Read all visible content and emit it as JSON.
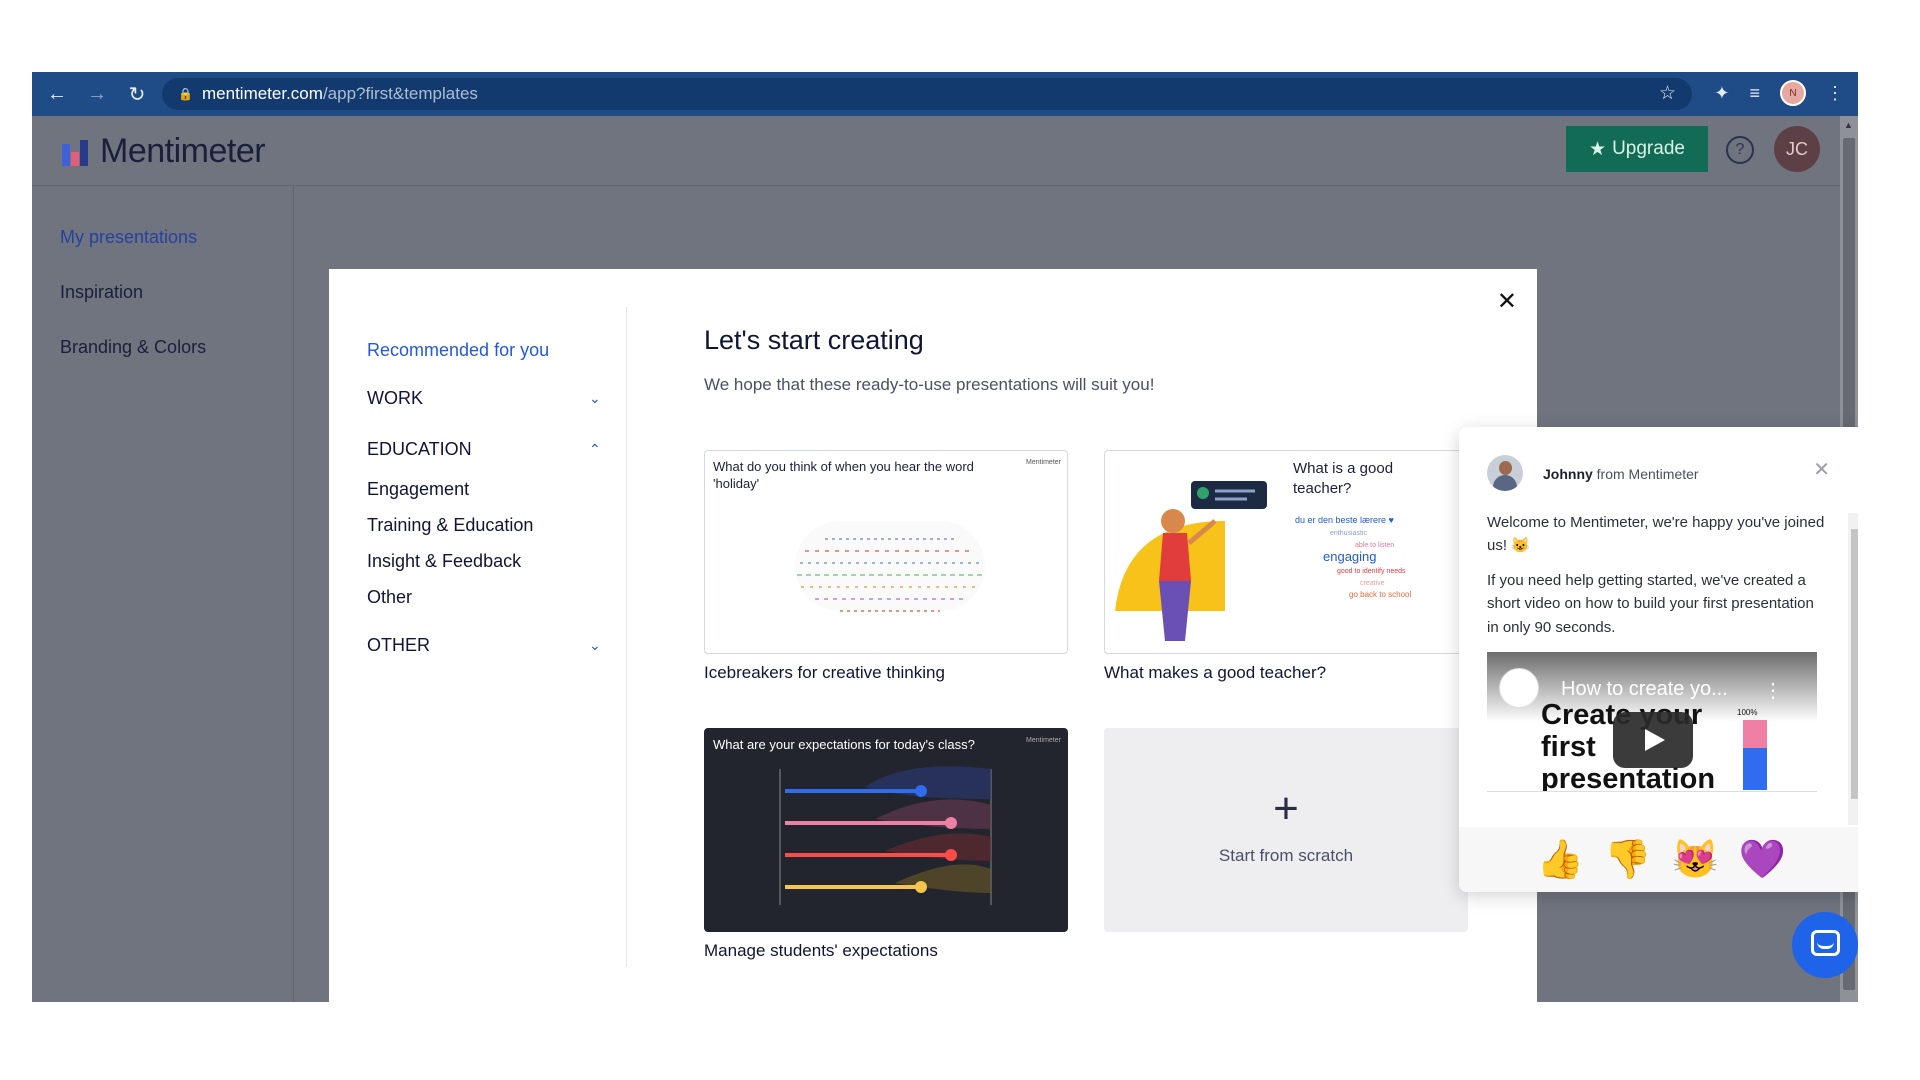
{
  "browser": {
    "url_host": "mentimeter.com",
    "url_path": "/app?first&templates",
    "icons": [
      "back-arrow-icon",
      "forward-arrow-icon",
      "reload-icon",
      "lock-icon",
      "star-icon",
      "puzzle-icon",
      "playlist-icon",
      "profile-icon",
      "kebab-menu-icon"
    ]
  },
  "header": {
    "brand": "Mentimeter",
    "upgrade_label": "Upgrade",
    "help_label": "?",
    "avatar_initials": "JC",
    "upgrade_color": "#116b55"
  },
  "sidebar": {
    "items": [
      {
        "label": "My presentations"
      },
      {
        "label": "Inspiration"
      },
      {
        "label": "Branding & Colors"
      }
    ]
  },
  "modal": {
    "nav": {
      "recommended": "Recommended for you",
      "work": "WORK",
      "education": "EDUCATION",
      "education_items": [
        "Engagement",
        "Training & Education",
        "Insight & Feedback",
        "Other"
      ],
      "other": "OTHER"
    },
    "title": "Let's start creating",
    "subtitle": "We hope that these ready-to-use presentations will suit you!",
    "cards": [
      {
        "question": "What do you think of when you hear the word 'holiday'",
        "caption": "Icebreakers for creative thinking"
      },
      {
        "question": "What is a good teacher?",
        "caption": "What makes a good teacher?"
      },
      {
        "question": "What are your expectations for today's class?",
        "caption": "Manage students' expectations"
      }
    ],
    "scratch_label": "Start from scratch",
    "brand_small": "Mentimeter",
    "accent": "#2259d6"
  },
  "chat": {
    "agent_name": "Johnny",
    "agent_from": "from Mentimeter",
    "message_1": "Welcome to Mentimeter, we're happy you've joined us! 😺",
    "message_2": "If you need help getting started, we've created a short video on how to build your first presentation in only 90 seconds.",
    "video_title": "How to create yo...",
    "video_big_text": "Create your first presentation",
    "video_pct": "100%",
    "reactions": [
      "👍",
      "👎",
      "😻",
      "💜"
    ]
  }
}
